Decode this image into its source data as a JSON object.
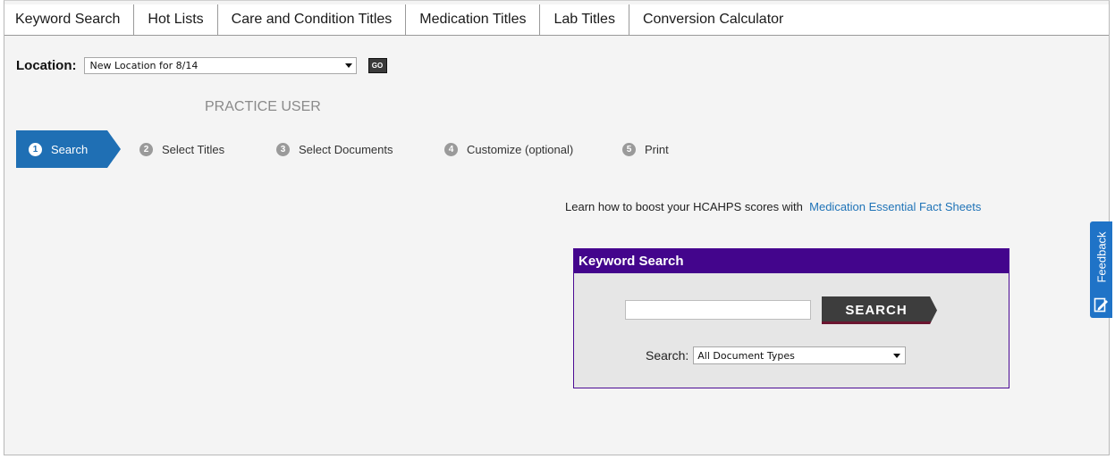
{
  "nav": {
    "tabs": [
      {
        "label": "Keyword Search"
      },
      {
        "label": "Hot Lists"
      },
      {
        "label": "Care and Condition Titles"
      },
      {
        "label": "Medication Titles"
      },
      {
        "label": "Lab Titles"
      },
      {
        "label": "Conversion Calculator"
      }
    ]
  },
  "location": {
    "label": "Location:",
    "selected": "New Location for 8/14",
    "go_label": "GO"
  },
  "user": {
    "name": "PRACTICE USER"
  },
  "steps": [
    {
      "number": "1",
      "label": "Search",
      "active": true
    },
    {
      "number": "2",
      "label": "Select Titles",
      "active": false
    },
    {
      "number": "3",
      "label": "Select Documents",
      "active": false
    },
    {
      "number": "4",
      "label": "Customize (optional)",
      "active": false
    },
    {
      "number": "5",
      "label": "Print",
      "active": false
    }
  ],
  "promo": {
    "text": "Learn how to boost your HCAHPS scores with",
    "link": "Medication Essential Fact Sheets"
  },
  "keyword_search": {
    "title": "Keyword Search",
    "input_value": "",
    "button_label": "SEARCH",
    "type_label": "Search:",
    "type_selected": "All Document Types"
  },
  "feedback": {
    "label": "Feedback"
  },
  "colors": {
    "active_step": "#1f6fb4",
    "kw_header": "#43058c",
    "feedback": "#1f73c7",
    "link": "#1f73b7"
  }
}
